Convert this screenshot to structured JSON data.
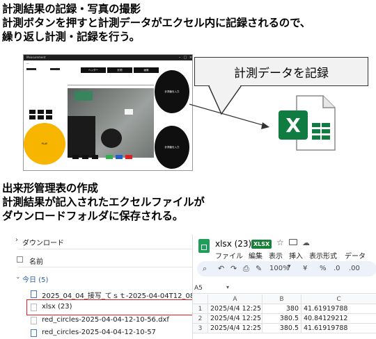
{
  "section1": {
    "line1": "計測結果の記録・写真の撮影",
    "line2": "計測ボタンを押すと計測データがエクセル内に記録されるので、",
    "line3": "繰り返し計測・記録を行う。"
  },
  "callout": {
    "text": "計測データを記録"
  },
  "excel_icon": {
    "letter": "X",
    "color": "#107c41"
  },
  "app": {
    "window_title": "Measurement",
    "tabs": [
      "ヘッダー",
      "計測",
      "画像"
    ],
    "yellow_button": "PLAY",
    "right_circle_top": "計測値を入力",
    "right_circle_bottom": "計測値を入力",
    "yellow_color": "#f7b500"
  },
  "section2": {
    "line1": "出来形管理表の作成",
    "line2": "計測結果が記入されたエクセルファイルが",
    "line3": "ダウンロードフォルダに保存される。"
  },
  "explorer": {
    "folder": "ダウンロード",
    "column_name": "名前",
    "group": "今日 (5)",
    "files": [
      "2025_04_04_接写_てｓｔ-2025-04-04T12_08...",
      "xlsx (23)",
      "red_circles-2025-04-04-12-10-56.dxf",
      "red_circles-2025-04-04-12-10-57"
    ],
    "highlight_color": "#e0201c"
  },
  "sheets": {
    "title": "xlsx (23)",
    "badge": "XLSX",
    "menu": [
      "ファイル",
      "編集",
      "表示",
      "挿入",
      "表示形式",
      "データ"
    ],
    "zoom": "100%",
    "currency": "¥",
    "percent": "%",
    "dec1": ".0",
    "dec2": ".00",
    "cell_ref": "A5",
    "columns": [
      "A",
      "B",
      "C"
    ],
    "rows": [
      {
        "num": "1",
        "a": "2025/4/4 12:25",
        "b": "380",
        "c": "41.61919788"
      },
      {
        "num": "2",
        "a": "2025/4/4 12:25",
        "b": "380.5",
        "c": "40.84129212"
      },
      {
        "num": "3",
        "a": "2025/4/4 12:25",
        "b": "380.5",
        "c": "41.61919788"
      }
    ]
  }
}
